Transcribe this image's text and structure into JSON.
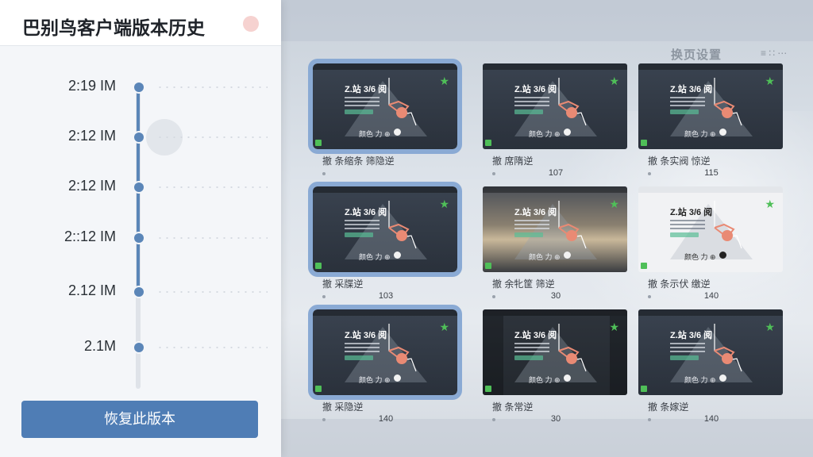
{
  "panel": {
    "title": "巴别鸟客户端版本历史",
    "restore_label": "恢复此版本"
  },
  "timeline": [
    {
      "time": "2:19 IM"
    },
    {
      "time": "2:12 IM"
    },
    {
      "time": "2:12 IM"
    },
    {
      "time": "2::12 IM"
    },
    {
      "time": "2.12 IM"
    },
    {
      "time": "2.1M"
    }
  ],
  "background": {
    "title_blur": "换页设置",
    "icons_blur": "≡ ∷ ⋯"
  },
  "grid": [
    {
      "thumb_title": "Z.站 3/6 阅",
      "caption": "颜色 力 ⊕",
      "title": "撤 条缩条 筛隐逆",
      "count": "",
      "style": "dark",
      "selected": true
    },
    {
      "thumb_title": "Z.站 3/6 阅",
      "caption": "颜色 力 ⊕",
      "title": "撤 席隋逆",
      "count": "107",
      "style": "dark",
      "selected": false
    },
    {
      "thumb_title": "Z.站 3/6 阅",
      "caption": "颜色 力 ⊕",
      "title": "撤 条实阀 惊逆",
      "count": "115",
      "style": "dark",
      "selected": false
    },
    {
      "thumb_title": "Z.站 3/6 阅",
      "caption": "颜色 力 ⊕",
      "title": "撤 采牒逆",
      "count": "103",
      "style": "dark",
      "selected": true
    },
    {
      "thumb_title": "Z.站 3/6 阅",
      "caption": "颜色 力 ⊕",
      "title": "撤 余牝筐 筛逆",
      "count": "30",
      "style": "sunset",
      "selected": false
    },
    {
      "thumb_title": "Z.站 3/6 阅",
      "caption": "颜色 力 ⊕",
      "title": "撤 条示伏 缴逆",
      "count": "140",
      "style": "light",
      "selected": false
    },
    {
      "thumb_title": "Z.站 3/6 阅",
      "caption": "颜色 力 ⊕",
      "title": "撤 采隐逆",
      "count": "140",
      "style": "dark",
      "selected": true
    },
    {
      "thumb_title": "Z.站 3/6 阅",
      "caption": "颜色 力 ⊕",
      "title": "撤 条常逆",
      "count": "30",
      "style": "dark2",
      "selected": false
    },
    {
      "thumb_title": "Z.站 3/6 阅",
      "caption": "颜色 力 ⊕",
      "title": "撤 条嫁逆",
      "count": "140",
      "style": "dark",
      "selected": false
    }
  ],
  "colors": {
    "accent": "#4f7db5",
    "timeline_node": "#5b86b8",
    "selection_outline": "#8aaad4",
    "graph_line": "#e98a74",
    "badge_green": "#4fbf58"
  }
}
